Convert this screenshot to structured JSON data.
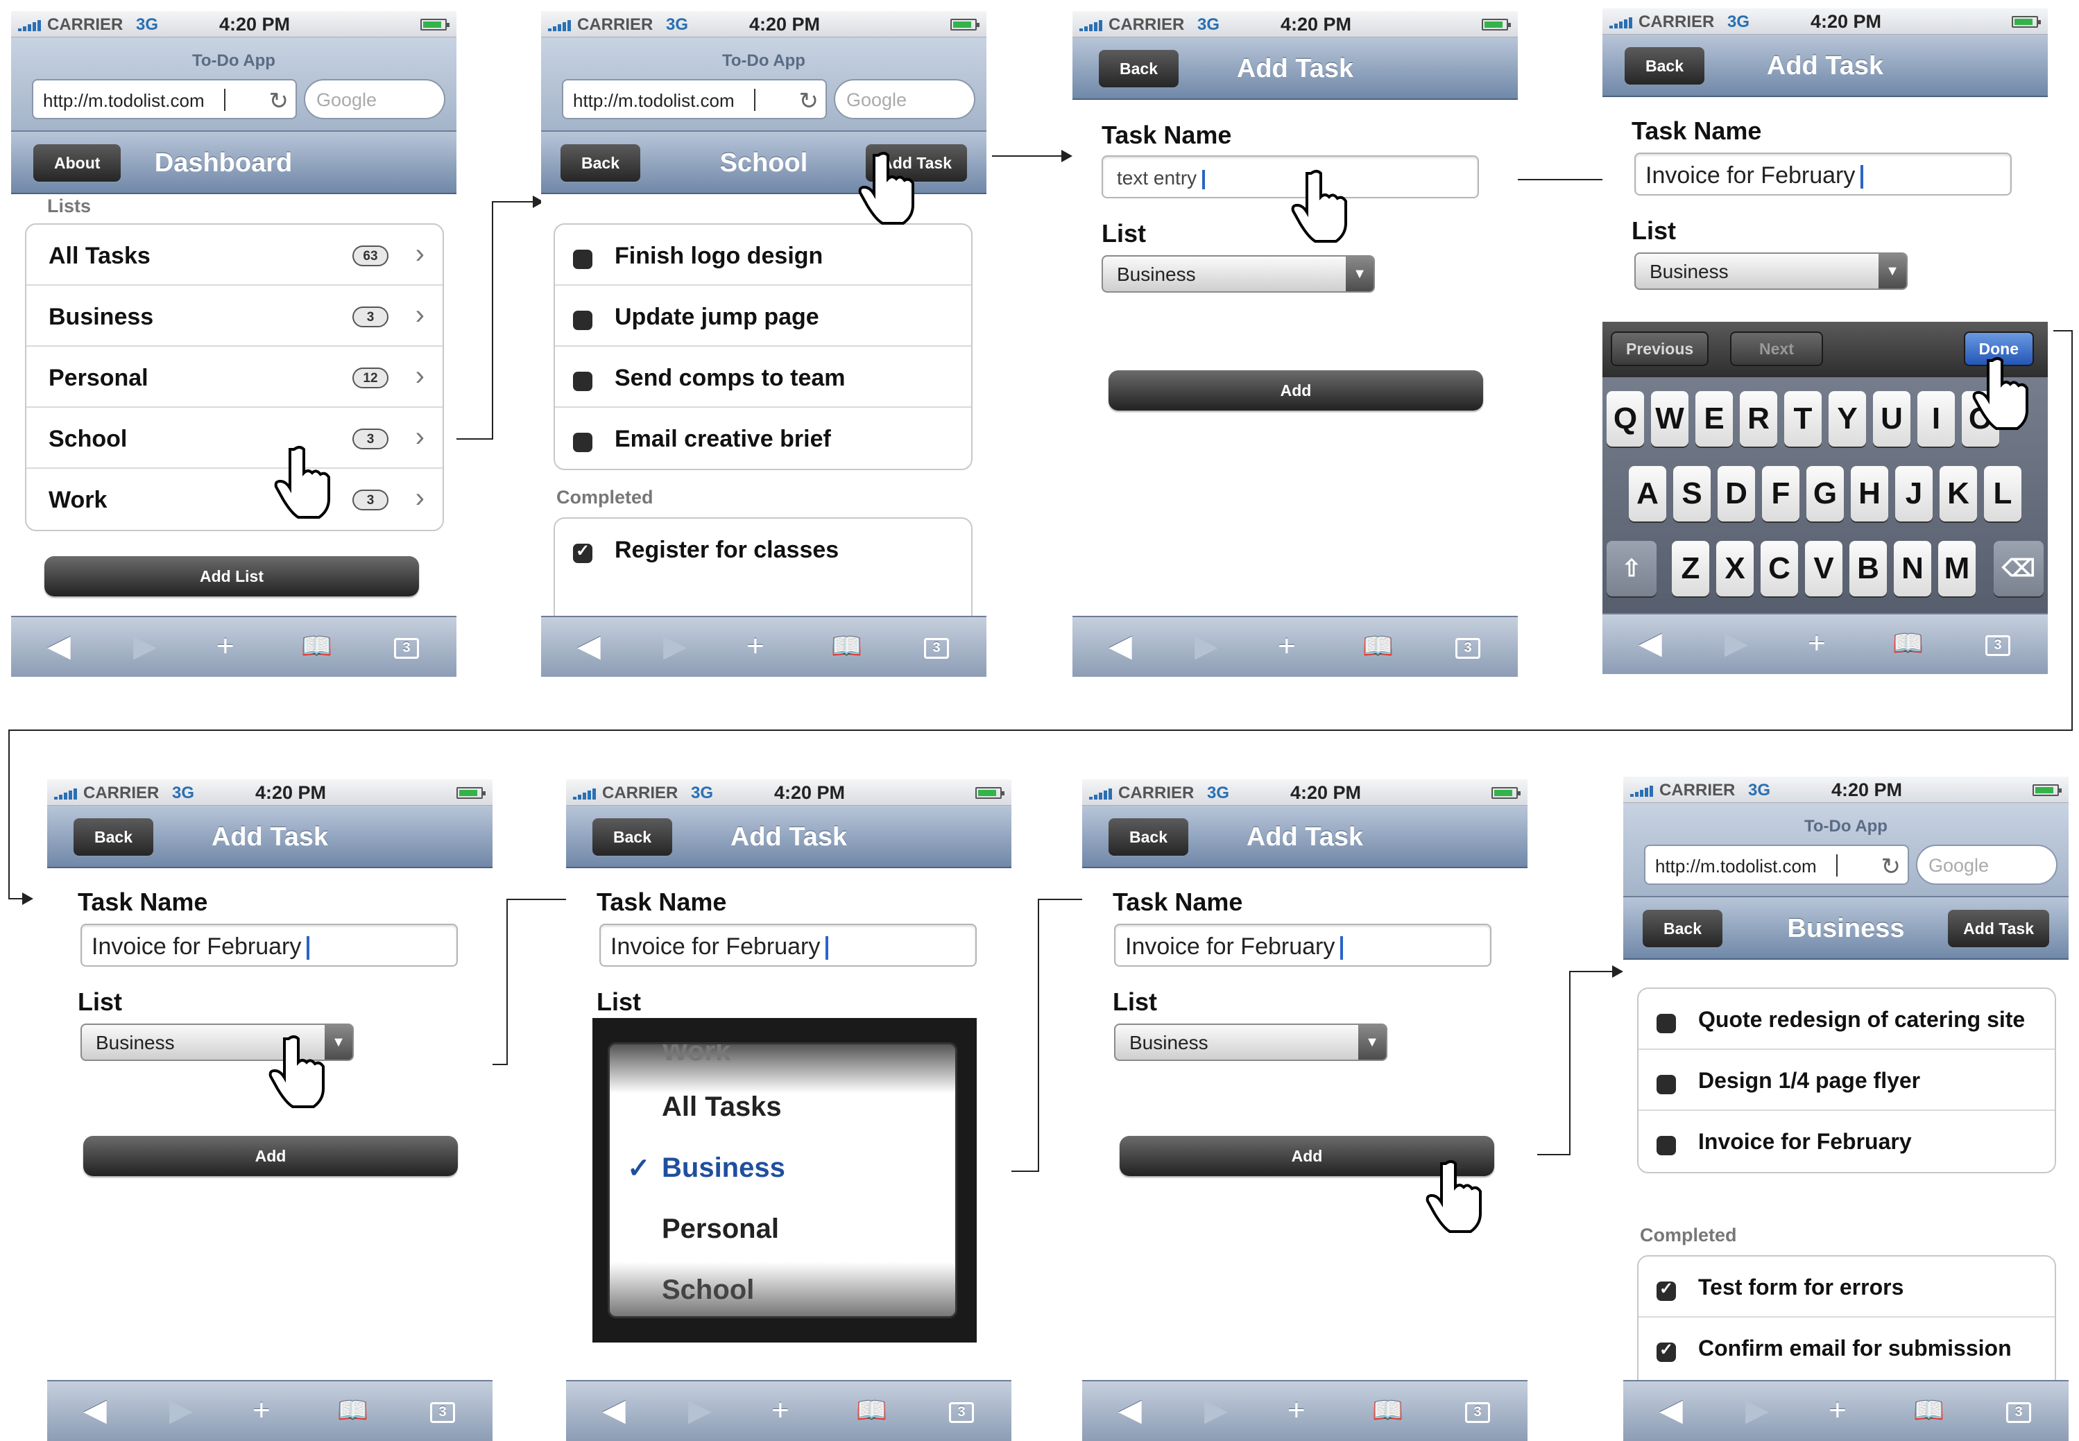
{
  "status": {
    "carrier": "CARRIER",
    "network": "3G",
    "time": "4:20 PM"
  },
  "browser": {
    "app_title": "To-Do App",
    "url": "http://m.todolist.com",
    "search_placeholder": "Google"
  },
  "toolbar": {
    "back_icon": "◀",
    "forward_icon": "▶",
    "add_icon": "+",
    "bookmarks_icon": "bookmarks-icon",
    "pages_count": "3"
  },
  "screen1": {
    "about_label": "About",
    "title": "Dashboard",
    "section": "Lists",
    "lists": [
      {
        "label": "All Tasks",
        "count": "63"
      },
      {
        "label": "Business",
        "count": "3"
      },
      {
        "label": "Personal",
        "count": "12"
      },
      {
        "label": "School",
        "count": "3"
      },
      {
        "label": "Work",
        "count": "3"
      }
    ],
    "add_list_label": "Add List"
  },
  "screen2": {
    "back_label": "Back",
    "title": "School",
    "add_task_label": "Add Task",
    "tasks": [
      "Finish logo design",
      "Update jump page",
      "Send comps to team",
      "Email creative brief"
    ],
    "completed_header": "Completed",
    "completed": [
      "Register for classes"
    ]
  },
  "screen3": {
    "back_label": "Back",
    "title": "Add Task",
    "task_name_label": "Task Name",
    "task_value": "text entry",
    "list_label": "List",
    "list_value": "Business",
    "add_label": "Add"
  },
  "screen4": {
    "back_label": "Back",
    "title": "Add Task",
    "task_name_label": "Task Name",
    "task_value": "Invoice for February",
    "list_label": "List",
    "list_value": "Business",
    "previous_label": "Previous",
    "next_label": "Next",
    "done_label": "Done",
    "keys_row1": [
      "Q",
      "W",
      "E",
      "R",
      "T",
      "Y",
      "U",
      "I",
      "O"
    ],
    "keys_row2": [
      "A",
      "S",
      "D",
      "F",
      "G",
      "H",
      "J",
      "K",
      "L"
    ],
    "keys_row3": [
      "Z",
      "X",
      "C",
      "V",
      "B",
      "N",
      "M"
    ]
  },
  "screen5": {
    "back_label": "Back",
    "title": "Add Task",
    "task_name_label": "Task Name",
    "task_value": "Invoice for February",
    "list_label": "List",
    "list_value": "Business",
    "add_label": "Add"
  },
  "screen6": {
    "back_label": "Back",
    "title": "Add Task",
    "task_name_label": "Task Name",
    "task_value": "Invoice for February",
    "list_label": "List",
    "picker_items": [
      "Work",
      "All Tasks",
      "Business",
      "Personal",
      "School"
    ],
    "picker_selected": "Business"
  },
  "screen7": {
    "back_label": "Back",
    "title": "Add Task",
    "task_name_label": "Task Name",
    "task_value": "Invoice for February",
    "list_label": "List",
    "list_value": "Business",
    "add_label": "Add"
  },
  "screen8": {
    "back_label": "Back",
    "title": "Business",
    "add_task_label": "Add Task",
    "tasks": [
      "Quote redesign of catering site",
      "Design 1/4 page flyer",
      "Invoice for February"
    ],
    "completed_header": "Completed",
    "completed": [
      "Test form for errors",
      "Confirm email for submission"
    ]
  },
  "colors": {
    "navbar": "#7088a8",
    "accent": "#2a64c8",
    "selected": "#1f4f9e"
  }
}
